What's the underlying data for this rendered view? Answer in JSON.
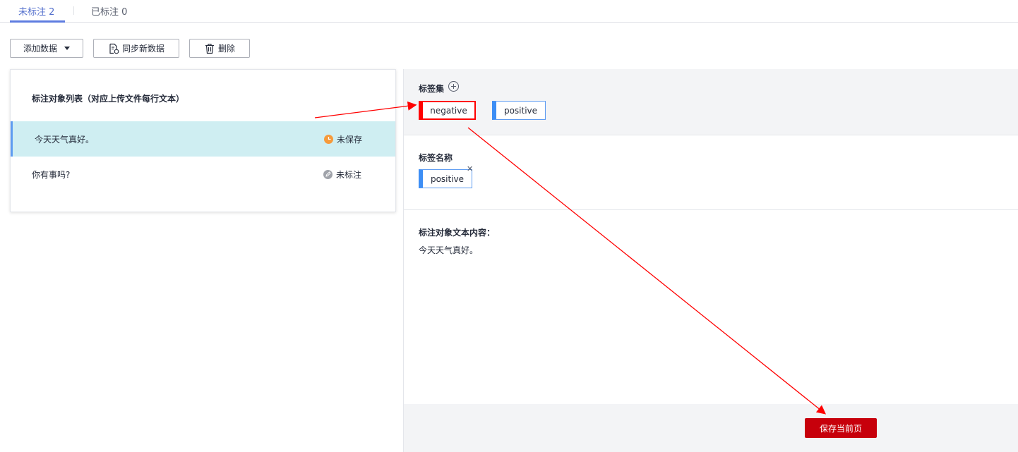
{
  "tabs": {
    "unlabeled": "未标注 2",
    "labeled": "已标注 0"
  },
  "toolbar": {
    "add_data": "添加数据",
    "sync_data": "同步新数据",
    "delete": "删除"
  },
  "left_panel": {
    "title": "标注对象列表（对应上传文件每行文本）",
    "items": [
      {
        "text": "今天天气真好。",
        "status": "未保存",
        "status_icon": "clock-icon"
      },
      {
        "text": "你有事吗?",
        "status": "未标注",
        "status_icon": "edit-icon"
      }
    ]
  },
  "right_panel": {
    "tagset_label": "标签集",
    "tags": [
      "negative",
      "positive"
    ],
    "tag_name_label": "标签名称",
    "selected_tag": "positive",
    "content_label": "标注对象文本内容：",
    "content_text": "今天天气真好。",
    "save_button": "保存当前页"
  },
  "colors": {
    "accent": "#5e7ce0",
    "tag_blue": "#3d8ef5",
    "highlight_red": "#ff0000",
    "save_red": "#c7000b",
    "row_selected": "#cfeef2",
    "status_orange": "#f69a3b"
  }
}
